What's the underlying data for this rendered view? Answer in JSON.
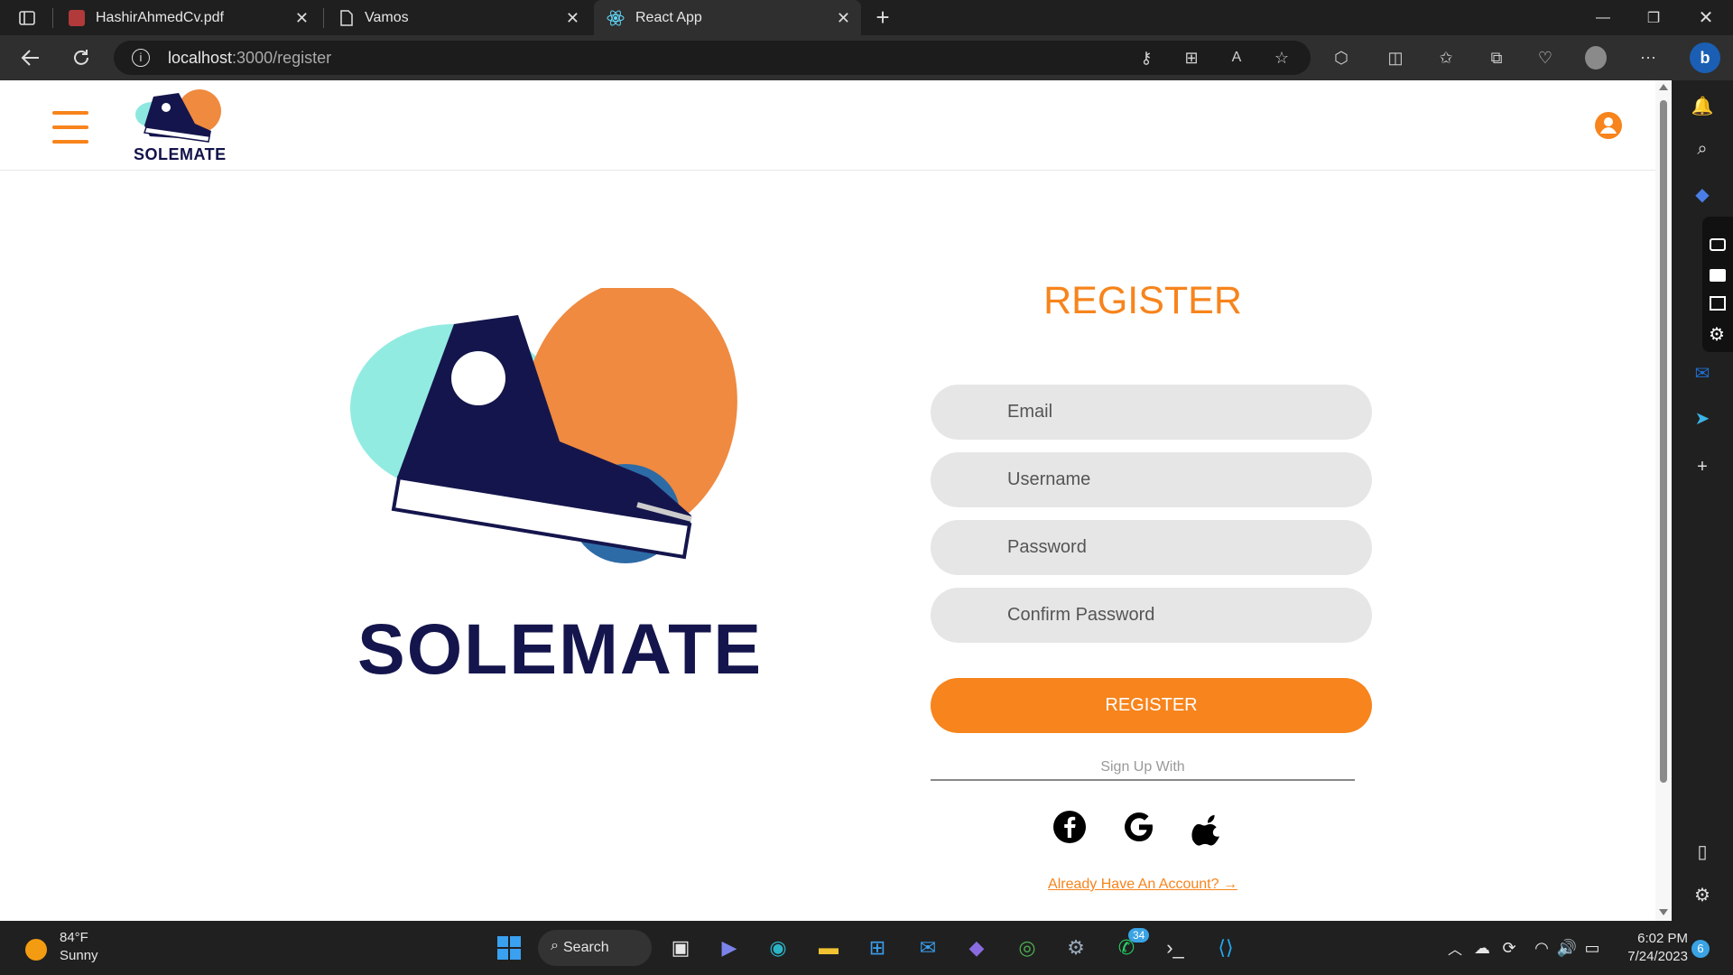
{
  "browser": {
    "tabs": [
      {
        "label": "HashirAhmedCv.pdf"
      },
      {
        "label": "Vamos"
      },
      {
        "label": "React App"
      }
    ],
    "url": {
      "host": "localhost",
      "path": ":3000/register"
    }
  },
  "header": {
    "logo_text": "SOLEMATE"
  },
  "hero": {
    "logo_text": "SOLEMATE"
  },
  "form": {
    "title": "REGISTER",
    "fields": [
      {
        "placeholder": "Email"
      },
      {
        "placeholder": "Username"
      },
      {
        "placeholder": "Password"
      },
      {
        "placeholder": "Confirm Password"
      }
    ],
    "submit_label": "REGISTER",
    "signup_with": "Sign Up With",
    "social": [
      "facebook-icon",
      "google-icon",
      "apple-icon"
    ],
    "already_link": "Already Have An Account? →"
  },
  "colors": {
    "accent": "#f7841c",
    "brand_navy": "#15154d",
    "field_bg": "#e6e6e6"
  },
  "taskbar": {
    "weather": {
      "temp": "84°F",
      "cond": "Sunny"
    },
    "search_label": "Search",
    "clock": {
      "time": "6:02 PM",
      "date": "7/24/2023"
    },
    "notif_count": "6",
    "whatsapp_badge": "34"
  }
}
